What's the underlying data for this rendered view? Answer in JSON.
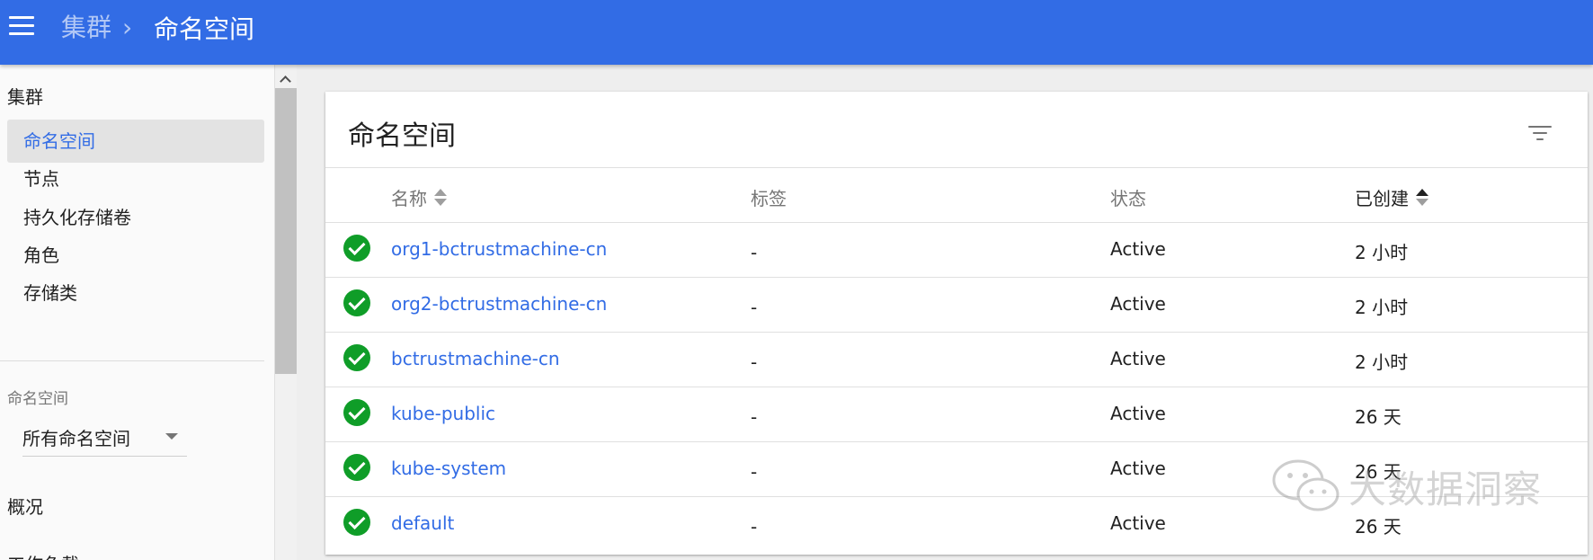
{
  "header": {
    "breadcrumb_parent": "集群",
    "breadcrumb_separator": "›",
    "breadcrumb_current": "命名空间",
    "menu_icon": "hamburger-menu-icon",
    "background_color": "#326ce5"
  },
  "sidebar": {
    "section_cluster": "集群",
    "items": [
      {
        "label": "命名空间",
        "active": true
      },
      {
        "label": "节点",
        "active": false
      },
      {
        "label": "持久化存储卷",
        "active": false
      },
      {
        "label": "角色",
        "active": false
      },
      {
        "label": "存储类",
        "active": false
      }
    ],
    "namespace_label": "命名空间",
    "namespace_select_value": "所有命名空间",
    "section_overview": "概况",
    "section_workloads": "工作负载"
  },
  "card": {
    "title": "命名空间",
    "filter_icon": "filter-list-icon",
    "columns": {
      "name": "名称",
      "labels": "标签",
      "status": "状态",
      "created": "已创建"
    },
    "sorted_column": "created",
    "rows": [
      {
        "name": "org1-bctrustmachine-cn",
        "labels": "-",
        "status": "Active",
        "age": "2 小时"
      },
      {
        "name": "org2-bctrustmachine-cn",
        "labels": "-",
        "status": "Active",
        "age": "2 小时"
      },
      {
        "name": "bctrustmachine-cn",
        "labels": "-",
        "status": "Active",
        "age": "2 小时"
      },
      {
        "name": "kube-public",
        "labels": "-",
        "status": "Active",
        "age": "26 天"
      },
      {
        "name": "kube-system",
        "labels": "-",
        "status": "Active",
        "age": "26 天"
      },
      {
        "name": "default",
        "labels": "-",
        "status": "Active",
        "age": "26 天"
      }
    ],
    "status_ok_color": "#0f9d28",
    "link_color": "#326ce5"
  },
  "watermark": {
    "text": "大数据洞察",
    "icon": "wechat-logo-icon"
  }
}
